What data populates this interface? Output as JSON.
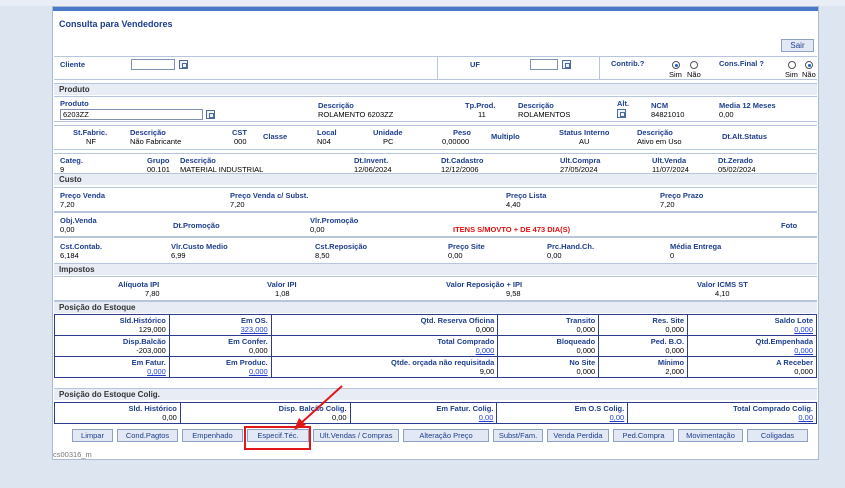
{
  "window": {
    "title": "Consulta para Vendedores",
    "sair": "Sair",
    "code": "cs00316_m"
  },
  "header": {
    "cliente_label": "Cliente",
    "cliente_value": "",
    "uf_label": "UF",
    "uf_value": "",
    "contrib_label": "Contrib.?",
    "contrib_sim": "Sim",
    "contrib_nao": "Não",
    "contrib_selected": "Sim",
    "consfinal_label": "Cons.Final ?",
    "consfinal_sim": "Sim",
    "consfinal_nao": "Não",
    "consfinal_selected": "Não"
  },
  "produto": {
    "section": "Produto",
    "produto_label": "Produto",
    "produto_value": "6203ZZ",
    "descricao_label": "Descrição",
    "descricao_value": "ROLAMENTO 6203ZZ",
    "tpprod_label": "Tp.Prod.",
    "tpprod_value": "11",
    "descricao2_label": "Descrição",
    "descricao2_value": "ROLAMENTOS",
    "alt_label": "Alt.",
    "ncm_label": "NCM",
    "ncm_value": "84821010",
    "media_label": "Media 12 Meses",
    "media_value": "0,00",
    "stfabric_label": "St.Fabric.",
    "stfabric_value": "NF",
    "descfab_label": "Descrição",
    "descfab_value": "Não Fabricante",
    "cst_label": "CST",
    "cst_value": "000",
    "classe_label": "Classe",
    "local_label": "Local",
    "local_value": "N04",
    "unidade_label": "Unidade",
    "unidade_value": "PC",
    "peso_label": "Peso",
    "peso_value": "0,00000",
    "multiplo_label": "Multiplo",
    "statusint_label": "Status Interno",
    "statusint_value": "AU",
    "descstatus_label": "Descrição",
    "descstatus_value": "Ativo em Uso",
    "dtaltstatus_label": "Dt.Alt.Status",
    "categ_label": "Categ.",
    "categ_value": "9",
    "grupo_label": "Grupo",
    "grupo_value": "00.101",
    "descgrupo_label": "Descrição",
    "descgrupo_value": "MATERIAL INDUSTRIAL",
    "dtinvent_label": "Dt.Invent.",
    "dtinvent_value": "12/06/2024",
    "dtcadastro_label": "Dt.Cadastro",
    "dtcadastro_value": "12/12/2006",
    "ultcompra_label": "Ult.Compra",
    "ultcompra_value": "27/05/2024",
    "ultvenda_label": "Ult.Venda",
    "ultvenda_value": "11/07/2024",
    "dtzerado_label": "Dt.Zerado",
    "dtzerado_value": "05/02/2024"
  },
  "custo": {
    "section": "Custo",
    "precovenda_label": "Preço Venda",
    "precovenda_value": "7,20",
    "precovendast_label": "Preço Venda c/ Subst.",
    "precovendast_value": "7,20",
    "precolista_label": "Preço Lista",
    "precolista_value": "4,40",
    "precoprazo_label": "Preço Prazo",
    "precoprazo_value": "7,20",
    "objvenda_label": "Obj.Venda",
    "objvenda_value": "0,00",
    "dtpromocao_label": "Dt.Promoção",
    "vlrpromocao_label": "Vlr.Promoção",
    "vlrpromocao_value": "0,00",
    "itens_alert": "ITENS S/MOVTO + DE 473 DIA(S)",
    "foto_label": "Foto",
    "cstcontab_label": "Cst.Contab.",
    "cstcontab_value": "6,184",
    "vlrcustomedio_label": "Vlr.Custo Medio",
    "vlrcustomedio_value": "6,99",
    "cstreposicao_label": "Cst.Reposição",
    "cstreposicao_value": "8,50",
    "precosite_label": "Preço Site",
    "precosite_value": "0,00",
    "prchand_label": "Prc.Hand.Ch.",
    "prchand_value": "0,00",
    "mediaentrega_label": "Média Entrega",
    "mediaentrega_value": "0"
  },
  "impostos": {
    "section": "Impostos",
    "aliquota_label": "Alíquota IPI",
    "aliquota_value": "7,80",
    "valoripi_label": "Valor IPI",
    "valoripi_value": "1,08",
    "valorrep_label": "Valor Reposição + IPI",
    "valorrep_value": "9,58",
    "valoricms_label": "Valor ICMS ST",
    "valoricms_value": "4,10"
  },
  "estoque": {
    "section": "Posição do Estoque",
    "rows": [
      [
        {
          "label": "Sld.Histórico",
          "value": "129,000",
          "link": false
        },
        {
          "label": "Em OS.",
          "value": "323,000",
          "link": true
        },
        {
          "label": "Qtd. Reserva Oficina",
          "value": "0,000",
          "link": false
        },
        {
          "label": "Transito",
          "value": "0,000",
          "link": false
        },
        {
          "label": "Res. Site",
          "value": "0,000",
          "link": false
        },
        {
          "label": "Saldo Lote",
          "value": "0,000",
          "link": true
        }
      ],
      [
        {
          "label": "Disp.Balcão",
          "value": "-203,000",
          "link": false
        },
        {
          "label": "Em Confer.",
          "value": "0,000",
          "link": false
        },
        {
          "label": "Total Comprado",
          "value": "0,000",
          "link": true
        },
        {
          "label": "Bloqueado",
          "value": "0,000",
          "link": false
        },
        {
          "label": "Ped. B.O.",
          "value": "0,000",
          "link": false
        },
        {
          "label": "Qtd.Empenhada",
          "value": "0,000",
          "link": true
        }
      ],
      [
        {
          "label": "Em Fatur.",
          "value": "0,000",
          "link": true
        },
        {
          "label": "Em Produc.",
          "value": "0,000",
          "link": true
        },
        {
          "label": "Qtde. orçada não requisitada",
          "value": "9,00",
          "link": false
        },
        {
          "label": "No Site",
          "value": "0,000",
          "link": false
        },
        {
          "label": "Mínimo",
          "value": "2,000",
          "link": false
        },
        {
          "label": "A Receber",
          "value": "0,000",
          "link": false
        }
      ]
    ]
  },
  "coligada": {
    "section": "Posição do Estoque Colig.",
    "cells": [
      {
        "label": "Sld. Histórico",
        "value": "0,00",
        "link": false
      },
      {
        "label": "Disp. Balcão Colig.",
        "value": "0,00",
        "link": false
      },
      {
        "label": "Em Fatur. Colig.",
        "value": "0,00",
        "link": true
      },
      {
        "label": "Em O.S Colig.",
        "value": "0,00",
        "link": true
      },
      {
        "label": "Total Comprado Colig.",
        "value": "0,00",
        "link": true
      }
    ]
  },
  "buttons": [
    "Limpar",
    "Cond.Pagtos",
    "Empenhado",
    "Especif.Téc.",
    "Ult.Vendas / Compras",
    "Alteração Preço",
    "Subst/Fam.",
    "Venda Perdida",
    "Ped.Compra",
    "Movimentação",
    "Coligadas"
  ],
  "colors": {
    "label": "#1d3d8f",
    "alert": "#e01010",
    "link": "#1f3fd8",
    "highlight": "#e01818"
  }
}
